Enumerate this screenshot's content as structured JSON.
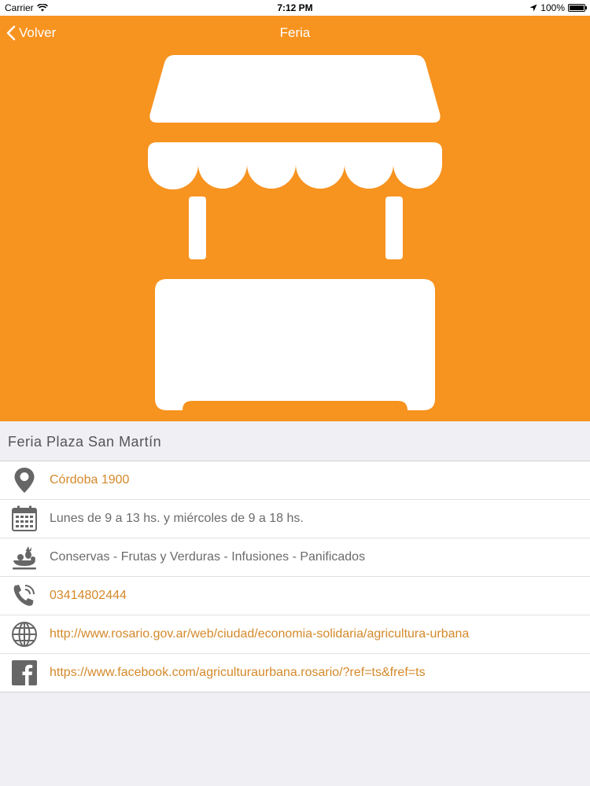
{
  "status_bar": {
    "carrier": "Carrier",
    "time": "7:12 PM",
    "battery": "100%"
  },
  "nav": {
    "back_label": "Volver",
    "title": "Feria"
  },
  "hero": {
    "icon": "market-stall-icon"
  },
  "section": {
    "title": "Feria Plaza San Martín"
  },
  "details": [
    {
      "icon": "location-pin-icon",
      "text": "Córdoba 1900"
    },
    {
      "icon": "calendar-icon",
      "text": "Lunes de 9 a 13 hs. y miércoles de 9 a 18 hs."
    },
    {
      "icon": "produce-basket-icon",
      "text": "Conservas - Frutas y Verduras - Infusiones - Panificados"
    },
    {
      "icon": "phone-icon",
      "text": "03414802444"
    },
    {
      "icon": "globe-icon",
      "text": "http://www.rosario.gov.ar/web/ciudad/economia-solidaria/agricultura-urbana"
    },
    {
      "icon": "facebook-icon",
      "text": "https://www.facebook.com/agriculturaurbana.rosario/?ref=ts&fref=ts"
    }
  ],
  "colors": {
    "accent": "#f7931f",
    "link": "#d4892a",
    "text": "#6b6b6b",
    "background": "#efeff4"
  }
}
